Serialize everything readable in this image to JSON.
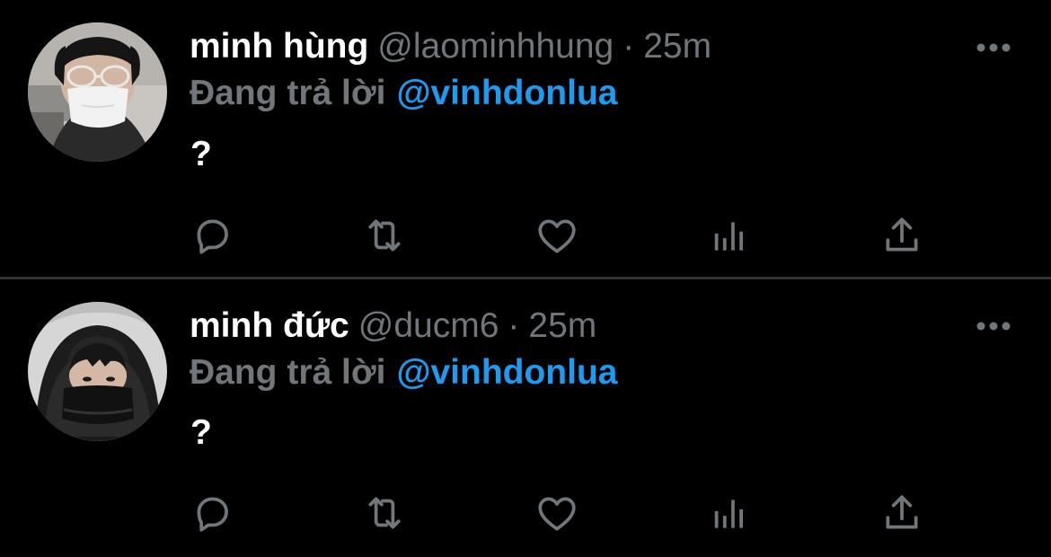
{
  "colors": {
    "background": "#000000",
    "primary_text": "#ffffff",
    "secondary_text": "#71767b",
    "accent": "#1d9bf0",
    "divider": "#2f3336"
  },
  "tweets": [
    {
      "name": "minh hùng",
      "handle": "@laominhhung",
      "separator": "·",
      "time": "25m",
      "reply_prefix": "Đang trả lời",
      "reply_to": "@vinhdonlua",
      "text": "?",
      "icons": [
        "more-icon",
        "reply-icon",
        "retweet-icon",
        "like-icon",
        "views-icon",
        "share-icon"
      ]
    },
    {
      "name": "minh đức",
      "handle": "@ducm6",
      "separator": "·",
      "time": "25m",
      "reply_prefix": "Đang trả lời",
      "reply_to": "@vinhdonlua",
      "text": "?",
      "icons": [
        "more-icon",
        "reply-icon",
        "retweet-icon",
        "like-icon",
        "views-icon",
        "share-icon"
      ]
    }
  ]
}
